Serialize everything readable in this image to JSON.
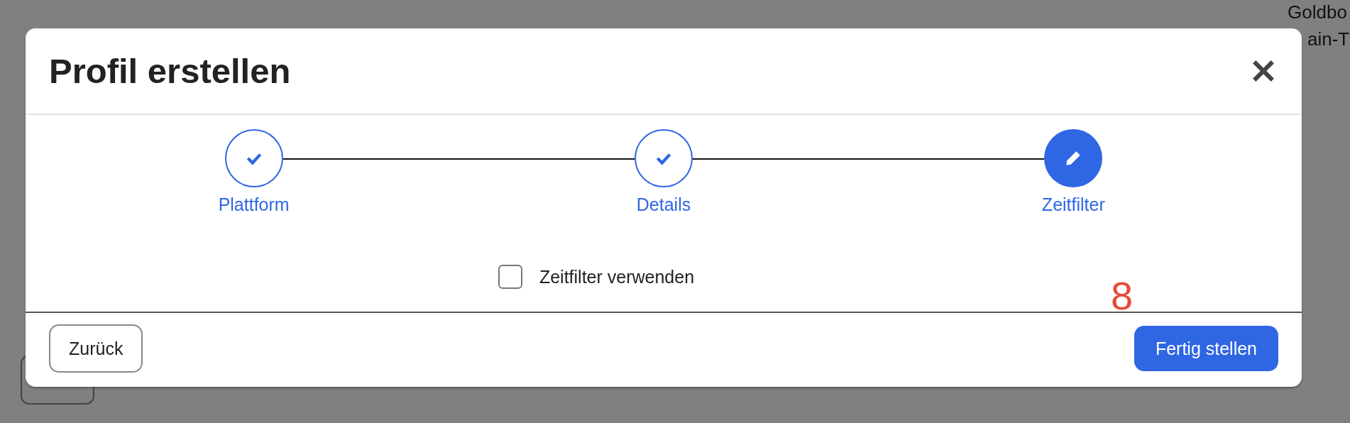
{
  "background": {
    "top_right_lines": [
      "Goldbo",
      "ain-T"
    ]
  },
  "dialog": {
    "title": "Profil erstellen",
    "steps": [
      {
        "label": "Plattform",
        "completed": true,
        "current": false
      },
      {
        "label": "Details",
        "completed": true,
        "current": false
      },
      {
        "label": "Zeitfilter",
        "completed": false,
        "current": true
      }
    ],
    "checkbox": {
      "label": "Zeitfilter verwenden",
      "checked": false
    },
    "marker": "8",
    "back_button": "Zurück",
    "finish_button": "Fertig stellen"
  }
}
